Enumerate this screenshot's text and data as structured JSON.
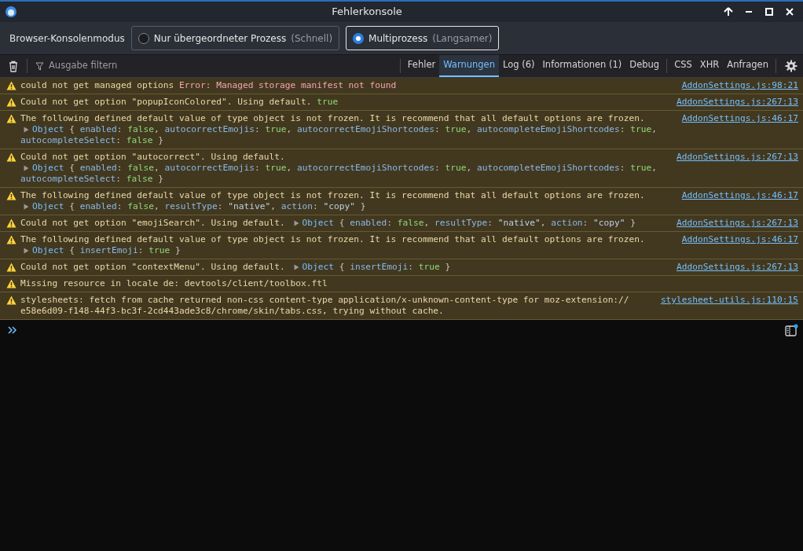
{
  "window": {
    "title": "Fehlerkonsole"
  },
  "mode_bar": {
    "label": "Browser-Konsolenmodus",
    "options": [
      {
        "label": "Nur übergeordneter Prozess",
        "hint": "(Schnell)",
        "selected": false
      },
      {
        "label": "Multiprozess",
        "hint": "(Langsamer)",
        "selected": true
      }
    ]
  },
  "toolbar": {
    "filter": {
      "placeholder": "Ausgabe filtern"
    },
    "levels": [
      {
        "label": "Fehler",
        "selected": false
      },
      {
        "label": "Warnungen",
        "selected": true
      },
      {
        "label": "Log (6)",
        "selected": false
      },
      {
        "label": "Informationen (1)",
        "selected": false
      },
      {
        "label": "Debug",
        "selected": false
      }
    ],
    "types": [
      {
        "label": "CSS",
        "selected": false
      },
      {
        "label": "XHR",
        "selected": false
      },
      {
        "label": "Anfragen",
        "selected": false
      }
    ]
  },
  "messages": [
    {
      "source": "AddonSettings.js:98:21",
      "lines": [
        [
          {
            "kind": "msg",
            "text": "could not get managed options "
          },
          {
            "kind": "err",
            "text": "Error: Managed storage manifest not found"
          }
        ]
      ]
    },
    {
      "source": "AddonSettings.js:267:13",
      "lines": [
        [
          {
            "kind": "msg",
            "text": "Could not get option \"popupIconColored\". Using default. "
          },
          {
            "kind": "val",
            "text": "true"
          }
        ]
      ]
    },
    {
      "source": "AddonSettings.js:46:17",
      "lines": [
        [
          {
            "kind": "msg",
            "text": "The following defined default value of type object is not frozen. It is recommend that all default options are frozen."
          }
        ],
        [
          {
            "kind": "toggle"
          },
          {
            "kind": "obj",
            "text": "Object"
          },
          {
            "kind": "punct",
            "text": " { "
          },
          {
            "kind": "key",
            "text": "enabled"
          },
          {
            "kind": "punct",
            "text": ": "
          },
          {
            "kind": "val",
            "text": "false"
          },
          {
            "kind": "punct",
            "text": ", "
          },
          {
            "kind": "key",
            "text": "autocorrectEmojis"
          },
          {
            "kind": "punct",
            "text": ": "
          },
          {
            "kind": "val",
            "text": "true"
          },
          {
            "kind": "punct",
            "text": ", "
          },
          {
            "kind": "key",
            "text": "autocorrectEmojiShortcodes"
          },
          {
            "kind": "punct",
            "text": ": "
          },
          {
            "kind": "val",
            "text": "true"
          },
          {
            "kind": "punct",
            "text": ", "
          },
          {
            "kind": "key",
            "text": "autocompleteEmojiShortcodes"
          },
          {
            "kind": "punct",
            "text": ": "
          },
          {
            "kind": "val",
            "text": "true"
          },
          {
            "kind": "punct",
            "text": ","
          }
        ],
        [
          {
            "kind": "key",
            "text": "autocompleteSelect"
          },
          {
            "kind": "punct",
            "text": ": "
          },
          {
            "kind": "val",
            "text": "false"
          },
          {
            "kind": "punct",
            "text": " }"
          }
        ]
      ]
    },
    {
      "source": "AddonSettings.js:267:13",
      "lines": [
        [
          {
            "kind": "msg",
            "text": "Could not get option \"autocorrect\". Using default."
          }
        ],
        [
          {
            "kind": "toggle"
          },
          {
            "kind": "obj",
            "text": "Object"
          },
          {
            "kind": "punct",
            "text": " { "
          },
          {
            "kind": "key",
            "text": "enabled"
          },
          {
            "kind": "punct",
            "text": ": "
          },
          {
            "kind": "val",
            "text": "false"
          },
          {
            "kind": "punct",
            "text": ", "
          },
          {
            "kind": "key",
            "text": "autocorrectEmojis"
          },
          {
            "kind": "punct",
            "text": ": "
          },
          {
            "kind": "val",
            "text": "true"
          },
          {
            "kind": "punct",
            "text": ", "
          },
          {
            "kind": "key",
            "text": "autocorrectEmojiShortcodes"
          },
          {
            "kind": "punct",
            "text": ": "
          },
          {
            "kind": "val",
            "text": "true"
          },
          {
            "kind": "punct",
            "text": ", "
          },
          {
            "kind": "key",
            "text": "autocompleteEmojiShortcodes"
          },
          {
            "kind": "punct",
            "text": ": "
          },
          {
            "kind": "val",
            "text": "true"
          },
          {
            "kind": "punct",
            "text": ","
          }
        ],
        [
          {
            "kind": "key",
            "text": "autocompleteSelect"
          },
          {
            "kind": "punct",
            "text": ": "
          },
          {
            "kind": "val",
            "text": "false"
          },
          {
            "kind": "punct",
            "text": " }"
          }
        ]
      ]
    },
    {
      "source": "AddonSettings.js:46:17",
      "lines": [
        [
          {
            "kind": "msg",
            "text": "The following defined default value of type object is not frozen. It is recommend that all default options are frozen."
          }
        ],
        [
          {
            "kind": "toggle"
          },
          {
            "kind": "obj",
            "text": "Object"
          },
          {
            "kind": "punct",
            "text": " { "
          },
          {
            "kind": "key",
            "text": "enabled"
          },
          {
            "kind": "punct",
            "text": ": "
          },
          {
            "kind": "val",
            "text": "false"
          },
          {
            "kind": "punct",
            "text": ", "
          },
          {
            "kind": "key",
            "text": "resultType"
          },
          {
            "kind": "punct",
            "text": ": "
          },
          {
            "kind": "str",
            "text": "\"native\""
          },
          {
            "kind": "punct",
            "text": ", "
          },
          {
            "kind": "key",
            "text": "action"
          },
          {
            "kind": "punct",
            "text": ": "
          },
          {
            "kind": "str",
            "text": "\"copy\""
          },
          {
            "kind": "punct",
            "text": " }"
          }
        ]
      ]
    },
    {
      "source": "AddonSettings.js:267:13",
      "lines": [
        [
          {
            "kind": "msg",
            "text": "Could not get option \"emojiSearch\". Using default. "
          },
          {
            "kind": "toggle"
          },
          {
            "kind": "obj",
            "text": "Object"
          },
          {
            "kind": "punct",
            "text": " { "
          },
          {
            "kind": "key",
            "text": "enabled"
          },
          {
            "kind": "punct",
            "text": ": "
          },
          {
            "kind": "val",
            "text": "false"
          },
          {
            "kind": "punct",
            "text": ", "
          },
          {
            "kind": "key",
            "text": "resultType"
          },
          {
            "kind": "punct",
            "text": ": "
          },
          {
            "kind": "str",
            "text": "\"native\""
          },
          {
            "kind": "punct",
            "text": ", "
          },
          {
            "kind": "key",
            "text": "action"
          },
          {
            "kind": "punct",
            "text": ": "
          },
          {
            "kind": "str",
            "text": "\"copy\""
          },
          {
            "kind": "punct",
            "text": " }"
          }
        ]
      ]
    },
    {
      "source": "AddonSettings.js:46:17",
      "lines": [
        [
          {
            "kind": "msg",
            "text": "The following defined default value of type object is not frozen. It is recommend that all default options are frozen."
          }
        ],
        [
          {
            "kind": "toggle"
          },
          {
            "kind": "obj",
            "text": "Object"
          },
          {
            "kind": "punct",
            "text": " { "
          },
          {
            "kind": "key",
            "text": "insertEmoji"
          },
          {
            "kind": "punct",
            "text": ": "
          },
          {
            "kind": "val",
            "text": "true"
          },
          {
            "kind": "punct",
            "text": " }"
          }
        ]
      ]
    },
    {
      "source": "AddonSettings.js:267:13",
      "lines": [
        [
          {
            "kind": "msg",
            "text": "Could not get option \"contextMenu\". Using default. "
          },
          {
            "kind": "toggle"
          },
          {
            "kind": "obj",
            "text": "Object"
          },
          {
            "kind": "punct",
            "text": " { "
          },
          {
            "kind": "key",
            "text": "insertEmoji"
          },
          {
            "kind": "punct",
            "text": ": "
          },
          {
            "kind": "val",
            "text": "true"
          },
          {
            "kind": "punct",
            "text": " }"
          }
        ]
      ]
    },
    {
      "lines": [
        [
          {
            "kind": "msg",
            "text": "Missing resource in locale de: devtools/client/toolbox.ftl"
          }
        ]
      ]
    },
    {
      "source": "stylesheet-utils.js:110:15",
      "lines": [
        [
          {
            "kind": "msg",
            "text": "stylesheets: fetch from cache returned non-css content-type application/x-unknown-content-type for moz-extension://"
          }
        ],
        [
          {
            "kind": "msg",
            "text": "e58e6d09-f148-44f3-bc3f-2cd443ade3c8/chrome/skin/tabs.css, trying without cache."
          }
        ]
      ]
    }
  ]
}
